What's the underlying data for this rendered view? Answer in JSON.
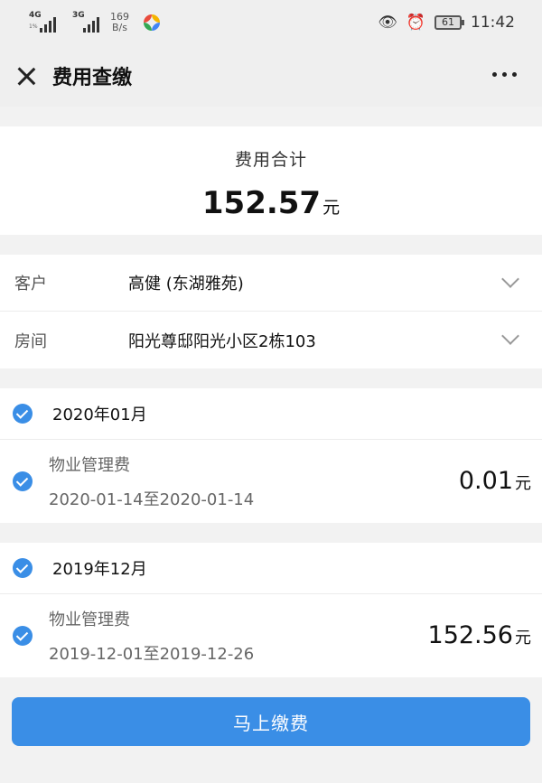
{
  "status_bar": {
    "net1": "4G",
    "net1_sub": "1%",
    "net2": "3G",
    "speed_value": "169",
    "speed_unit": "B/s",
    "battery": "61",
    "time": "11:42"
  },
  "navbar": {
    "title": "费用查缴"
  },
  "total": {
    "label": "费用合计",
    "amount": "152.57",
    "unit": "元"
  },
  "info": {
    "customer_label": "客户",
    "customer_value": "高健 (东湖雅苑)",
    "room_label": "房间",
    "room_value": "阳光尊邸阳光小区2栋103"
  },
  "months": [
    {
      "label": "2020年01月",
      "items": [
        {
          "name": "物业管理费",
          "range": "2020-01-14至2020-01-14",
          "amount": "0.01",
          "unit": "元"
        }
      ]
    },
    {
      "label": "2019年12月",
      "items": [
        {
          "name": "物业管理费",
          "range": "2019-12-01至2019-12-26",
          "amount": "152.56",
          "unit": "元"
        }
      ]
    }
  ],
  "pay_button": "马上缴费",
  "colors": {
    "accent": "#3a8ee6"
  }
}
